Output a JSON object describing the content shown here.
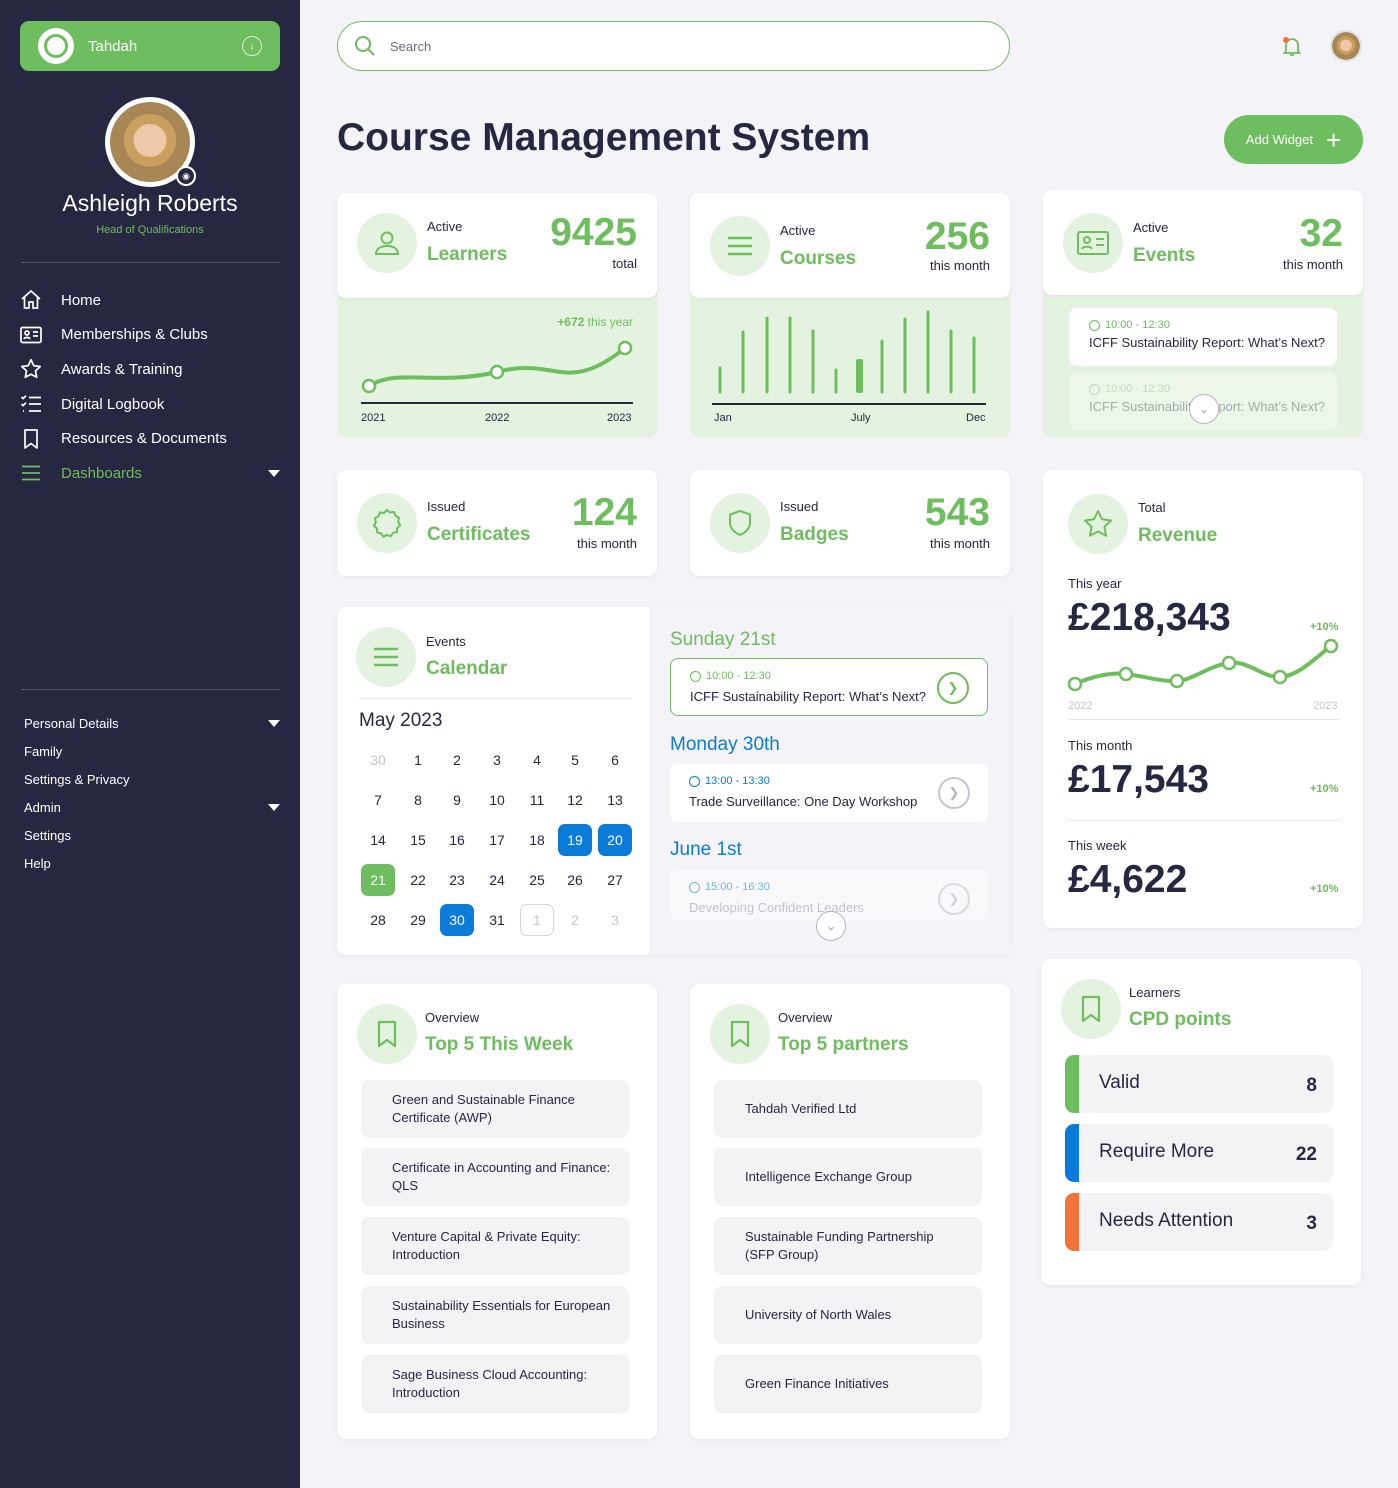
{
  "sidebar": {
    "brand": "Tahdah",
    "user_name": "Ashleigh Roberts",
    "user_role": "Head of Qualifications",
    "nav": [
      {
        "label": "Home",
        "icon": "home-icon"
      },
      {
        "label": "Memberships & Clubs",
        "icon": "id-card-icon"
      },
      {
        "label": "Awards & Training",
        "icon": "star-icon"
      },
      {
        "label": "Digital Logbook",
        "icon": "checklist-icon"
      },
      {
        "label": "Resources & Documents",
        "icon": "bookmark-icon"
      },
      {
        "label": "Dashboards",
        "icon": "menu-icon"
      }
    ],
    "sub_nav": [
      "Personal Details",
      "Family",
      "Settings & Privacy",
      "Admin",
      "Settings",
      "Help"
    ]
  },
  "header": {
    "search_placeholder": "Search",
    "page_title": "Course Management System",
    "add_widget": "Add Widget"
  },
  "learners": {
    "label_small": "Active",
    "label_big": "Learners",
    "value": "9425",
    "unit": "total",
    "delta": "+672",
    "delta_suffix": "this year",
    "x_labels": [
      "2021",
      "2022",
      "2023"
    ]
  },
  "courses": {
    "label_small": "Active",
    "label_big": "Courses",
    "value": "256",
    "unit": "this month",
    "x_labels": [
      "Jan",
      "July",
      "Dec"
    ]
  },
  "events": {
    "label_small": "Active",
    "label_big": "Events",
    "value": "32",
    "unit": "this month",
    "items": [
      {
        "time": "10:00 - 12:30",
        "title": "ICFF Sustainability Report: What’s Next?"
      },
      {
        "time": "10:00 - 12:30",
        "title": "ICFF Sustainability Report: What’s Next?"
      }
    ]
  },
  "certificates": {
    "label_small": "Issued",
    "label_big": "Certificates",
    "value": "124",
    "unit": "this month"
  },
  "badges": {
    "label_small": "Issued",
    "label_big": "Badges",
    "value": "543",
    "unit": "this month"
  },
  "revenue": {
    "label_small": "Total",
    "label_big": "Revenue",
    "year_label": "This year",
    "year_value": "£218,343",
    "year_pct": "+10%",
    "chart_start": "2022",
    "chart_end": "2023",
    "month_label": "This month",
    "month_value": "£17,543",
    "month_pct": "+10%",
    "week_label": "This week",
    "week_value": "£4,622",
    "week_pct": "+10%"
  },
  "calendar": {
    "label_small": "Events",
    "label_big": "Calendar",
    "month": "May 2023",
    "days": [
      {
        "d": "30",
        "s": "dim"
      },
      {
        "d": "1",
        "s": ""
      },
      {
        "d": "2",
        "s": ""
      },
      {
        "d": "3",
        "s": ""
      },
      {
        "d": "4",
        "s": ""
      },
      {
        "d": "5",
        "s": ""
      },
      {
        "d": "6",
        "s": ""
      },
      {
        "d": "7",
        "s": ""
      },
      {
        "d": "8",
        "s": ""
      },
      {
        "d": "9",
        "s": ""
      },
      {
        "d": "10",
        "s": ""
      },
      {
        "d": "11",
        "s": ""
      },
      {
        "d": "12",
        "s": ""
      },
      {
        "d": "13",
        "s": ""
      },
      {
        "d": "14",
        "s": ""
      },
      {
        "d": "15",
        "s": ""
      },
      {
        "d": "16",
        "s": ""
      },
      {
        "d": "17",
        "s": ""
      },
      {
        "d": "18",
        "s": ""
      },
      {
        "d": "19",
        "s": "blue"
      },
      {
        "d": "20",
        "s": "blue"
      },
      {
        "d": "21",
        "s": "green"
      },
      {
        "d": "22",
        "s": ""
      },
      {
        "d": "23",
        "s": ""
      },
      {
        "d": "24",
        "s": ""
      },
      {
        "d": "25",
        "s": ""
      },
      {
        "d": "26",
        "s": ""
      },
      {
        "d": "27",
        "s": ""
      },
      {
        "d": "28",
        "s": ""
      },
      {
        "d": "29",
        "s": ""
      },
      {
        "d": "30",
        "s": "blue"
      },
      {
        "d": "31",
        "s": ""
      },
      {
        "d": "1",
        "s": "box"
      },
      {
        "d": "2",
        "s": "dim"
      },
      {
        "d": "3",
        "s": "dim"
      }
    ],
    "schedule": [
      {
        "date": "Sunday 21st",
        "time": "10:00 - 12:30",
        "title": "ICFF Sustainability Report: What’s Next?"
      },
      {
        "date": "Monday 30th",
        "time": "13:00 - 13:30",
        "title": "Trade Surveillance: One Day Workshop"
      },
      {
        "date": "June 1st",
        "time": "15:00 - 16:30",
        "title": "Developing Confident Leaders"
      }
    ]
  },
  "top5_week": {
    "label_small": "Overview",
    "label_big": "Top 5 This Week",
    "items": [
      "Green and Sustainable Finance Certificate (AWP)",
      "Certificate in Accounting and Finance: QLS",
      "Venture Capital & Private Equity: Introduction",
      "Sustainability Essentials for European Business",
      "Sage Business Cloud Accounting: Introduction"
    ]
  },
  "top5_partners": {
    "label_small": "Overview",
    "label_big": "Top 5 partners",
    "items": [
      "Tahdah Verified Ltd",
      "Intelligence Exchange Group",
      "Sustainable Funding Partnership (SFP Group)",
      "University of North Wales",
      "Green Finance Initiatives"
    ]
  },
  "cpd": {
    "label_small": "Learners",
    "label_big": "CPD points",
    "rows": [
      {
        "label": "Valid",
        "value": "8",
        "color": "#6ebd5e"
      },
      {
        "label": "Require More",
        "value": "22",
        "color": "#0b7bd9"
      },
      {
        "label": "Needs Attention",
        "value": "3",
        "color": "#f3743a"
      }
    ]
  },
  "colors": {
    "accent": "#6ebd5e",
    "sidebar": "#262741",
    "blue": "#0b7bd9",
    "orange": "#f3743a"
  }
}
